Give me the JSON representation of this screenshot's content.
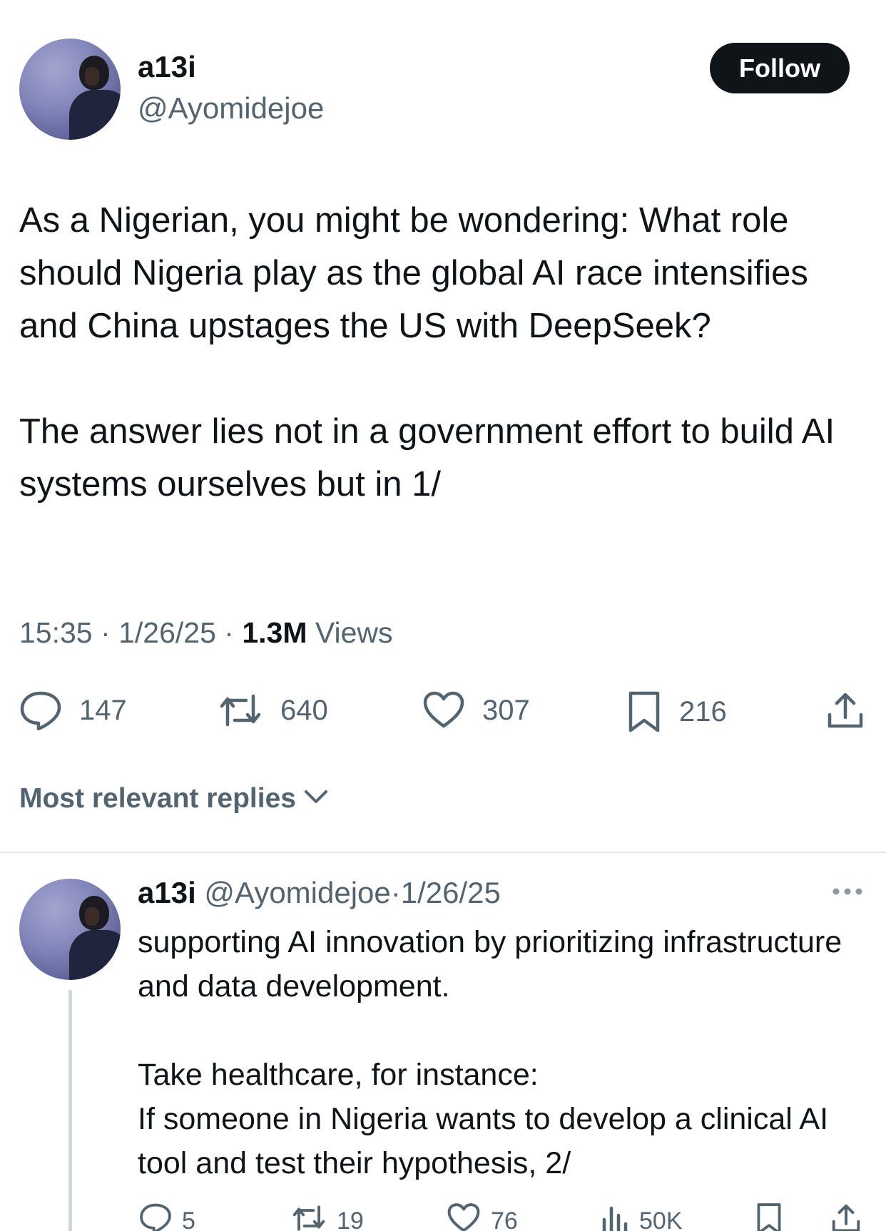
{
  "tweet": {
    "author_name": "a13i",
    "author_handle": "@Ayomidejoe",
    "follow_label": "Follow",
    "paragraphs": [
      "As a Nigerian, you might be wondering: What role should Nigeria play as the global AI race intensifies and China upstages the US with DeepSeek?",
      "The answer lies not in a government effort to build AI systems ourselves but in 1/"
    ],
    "time": "15:35",
    "date": "1/26/25",
    "views_count": "1.3M",
    "views_label": "Views",
    "separator": "·",
    "stats": {
      "replies": "147",
      "reposts": "640",
      "likes": "307",
      "bookmarks": "216"
    },
    "icons": [
      "reply-icon",
      "repost-icon",
      "like-icon",
      "bookmark-icon",
      "share-icon"
    ]
  },
  "replies_sort": {
    "label": "Most relevant replies"
  },
  "reply": {
    "author_name": "a13i",
    "author_handle": "@Ayomidejoe",
    "separator": "·",
    "date": "1/26/25",
    "paragraphs": [
      "supporting AI innovation by prioritizing infrastructure and data development.",
      "Take healthcare, for instance:\nIf someone in Nigeria wants to develop a clinical AI tool and test their hypothesis, 2/"
    ],
    "stats": {
      "replies": "5",
      "reposts": "19",
      "likes": "76",
      "views": "50K"
    },
    "icons": [
      "reply-icon",
      "repost-icon",
      "like-icon",
      "views-icon",
      "bookmark-icon",
      "share-icon",
      "more-icon"
    ]
  },
  "colors": {
    "text": "#0f1419",
    "secondary": "#536471",
    "follow_bg": "#0f1419",
    "divider": "#e1e6ea"
  }
}
